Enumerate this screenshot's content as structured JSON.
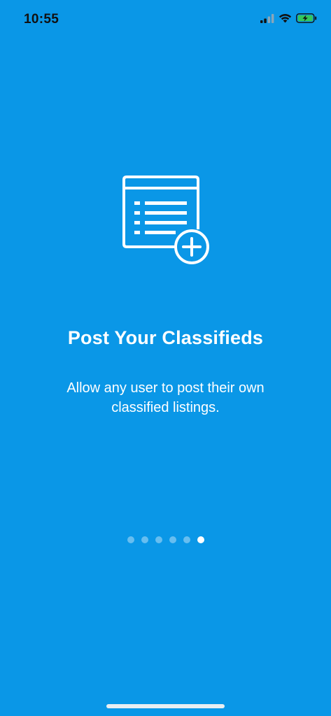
{
  "status_bar": {
    "time": "10:55",
    "icons": [
      "cellular-signal-icon",
      "wifi-icon",
      "battery-charging-icon"
    ]
  },
  "onboarding": {
    "icon": "add-listing-icon",
    "title": "Post Your Classifieds",
    "description": "Allow any user to post their own classified listings.",
    "pagination": {
      "total_pages": 6,
      "current_page": 6
    }
  },
  "colors": {
    "background": "#0A97E7",
    "foreground": "#FFFFFF",
    "battery_charge": "#34C759"
  }
}
